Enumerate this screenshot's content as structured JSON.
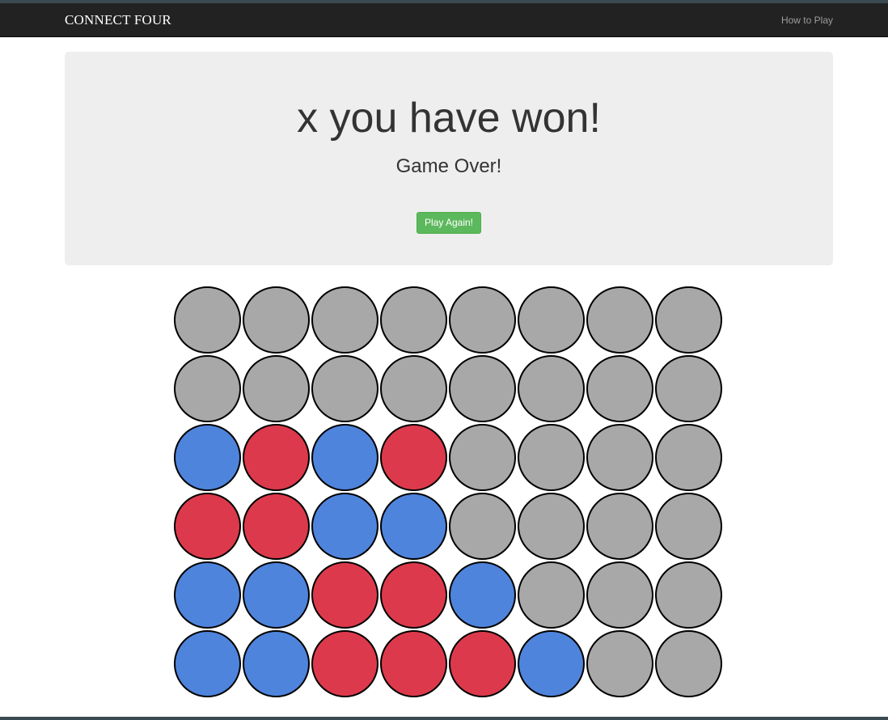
{
  "navbar": {
    "brand": "CONNECT FOUR",
    "how_to_play": "How to Play"
  },
  "banner": {
    "title": "x you have won!",
    "subtitle": "Game Over!",
    "play_again_label": "Play Again!"
  },
  "board": {
    "rows": 6,
    "cols": 8,
    "colors": {
      "empty": "#a8a8a8",
      "red": "#dc3a4c",
      "blue": "#4e84dc"
    },
    "cells": [
      [
        "empty",
        "empty",
        "empty",
        "empty",
        "empty",
        "empty",
        "empty",
        "empty"
      ],
      [
        "empty",
        "empty",
        "empty",
        "empty",
        "empty",
        "empty",
        "empty",
        "empty"
      ],
      [
        "blue",
        "red",
        "blue",
        "red",
        "empty",
        "empty",
        "empty",
        "empty"
      ],
      [
        "red",
        "red",
        "blue",
        "blue",
        "empty",
        "empty",
        "empty",
        "empty"
      ],
      [
        "blue",
        "blue",
        "red",
        "red",
        "blue",
        "empty",
        "empty",
        "empty"
      ],
      [
        "blue",
        "blue",
        "red",
        "red",
        "red",
        "blue",
        "empty",
        "empty"
      ]
    ]
  }
}
